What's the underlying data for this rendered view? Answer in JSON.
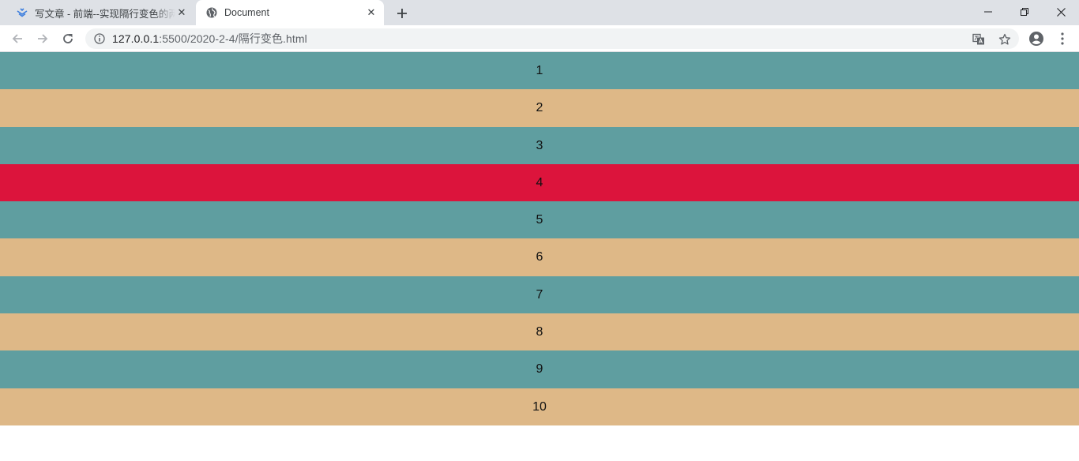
{
  "browser": {
    "tabs": [
      {
        "title": "写文章 - 前端--实现隔行变色的两",
        "favicon": "csdn-write-icon",
        "active": false
      },
      {
        "title": "Document",
        "favicon": "globe-icon",
        "active": true
      }
    ],
    "address": {
      "host": "127.0.0.1",
      "path": ":5500/2020-2-4/隔行变色.html"
    }
  },
  "page": {
    "colors": {
      "odd": "#5f9ea0",
      "even": "#deb887",
      "highlight": "#dc143c"
    },
    "highlighted_item": "4",
    "items": [
      "1",
      "2",
      "3",
      "4",
      "5",
      "6",
      "7",
      "8",
      "9",
      "10"
    ]
  }
}
